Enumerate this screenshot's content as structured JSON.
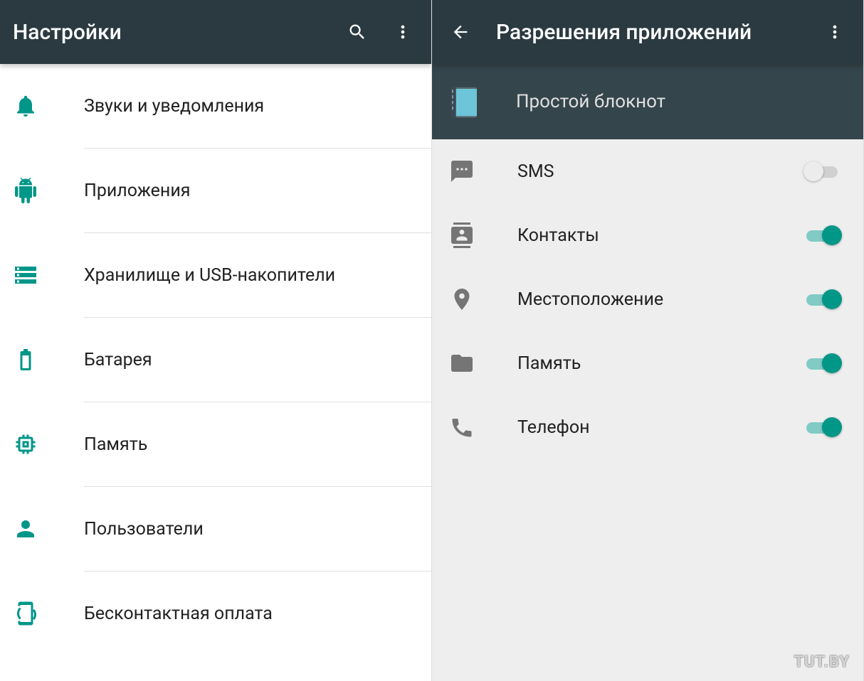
{
  "colors": {
    "accent": "#009688",
    "appbar": "#2b3a40",
    "subheader": "#35454c",
    "perm_icon": "#757575"
  },
  "left": {
    "title": "Настройки",
    "items": [
      {
        "icon": "bell-icon",
        "label": "Звуки и уведомления"
      },
      {
        "icon": "apps-icon",
        "label": "Приложения"
      },
      {
        "icon": "storage-icon",
        "label": "Хранилище и USB-накопители"
      },
      {
        "icon": "battery-icon",
        "label": "Батарея"
      },
      {
        "icon": "memory-icon",
        "label": "Память"
      },
      {
        "icon": "user-icon",
        "label": "Пользователи"
      },
      {
        "icon": "nfc-icon",
        "label": "Бесконтактная оплата"
      }
    ]
  },
  "right": {
    "title": "Разрешения приложений",
    "app_name": "Простой блокнот",
    "permissions": [
      {
        "icon": "sms-icon",
        "label": "SMS",
        "on": false
      },
      {
        "icon": "contacts-icon",
        "label": "Контакты",
        "on": true
      },
      {
        "icon": "location-icon",
        "label": "Местоположение",
        "on": true
      },
      {
        "icon": "folder-icon",
        "label": "Память",
        "on": true
      },
      {
        "icon": "phone-icon",
        "label": "Телефон",
        "on": true
      }
    ]
  },
  "watermark": "TUT.BY"
}
